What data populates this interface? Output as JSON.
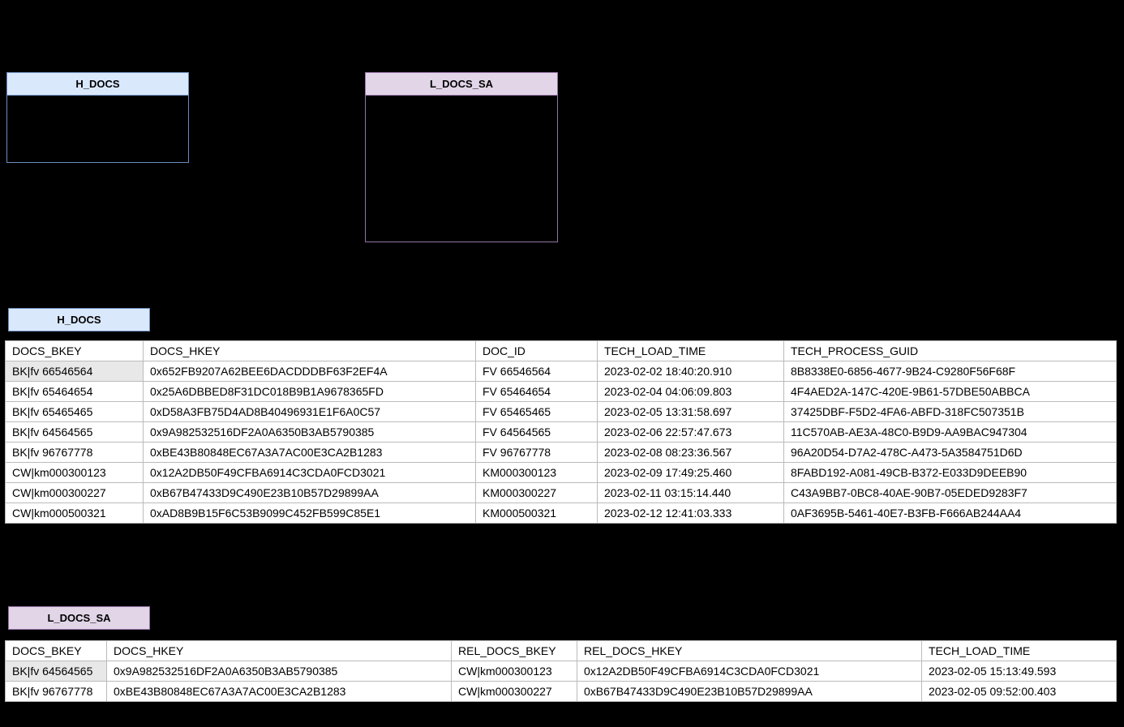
{
  "er": {
    "hdocs": {
      "title": "H_DOCS"
    },
    "ldocs": {
      "title": "L_DOCS_SA"
    }
  },
  "tabs": {
    "hdocs": "H_DOCS",
    "ldocs": "L_DOCS_SA"
  },
  "table1": {
    "headers": [
      "DOCS_BKEY",
      "DOCS_HKEY",
      "DOC_ID",
      "TECH_LOAD_TIME",
      "TECH_PROCESS_GUID"
    ],
    "rows": [
      [
        "BK|fv 66546564",
        "0x652FB9207A62BEE6DACDDDBF63F2EF4A",
        "FV 66546564",
        "2023-02-02 18:40:20.910",
        "8B8338E0-6856-4677-9B24-C9280F56F68F"
      ],
      [
        "BK|fv 65464654",
        "0x25A6DBBED8F31DC018B9B1A9678365FD",
        "FV 65464654",
        "2023-02-04 04:06:09.803",
        "4F4AED2A-147C-420E-9B61-57DBE50ABBCA"
      ],
      [
        "BK|fv 65465465",
        "0xD58A3FB75D4AD8B40496931E1F6A0C57",
        "FV 65465465",
        "2023-02-05 13:31:58.697",
        "37425DBF-F5D2-4FA6-ABFD-318FC507351B"
      ],
      [
        "BK|fv 64564565",
        "0x9A982532516DF2A0A6350B3AB5790385",
        "FV 64564565",
        "2023-02-06 22:57:47.673",
        "11C570AB-AE3A-48C0-B9D9-AA9BAC947304"
      ],
      [
        "BK|fv 96767778",
        "0xBE43B80848EC67A3A7AC00E3CA2B1283",
        "FV 96767778",
        "2023-02-08 08:23:36.567",
        "96A20D54-D7A2-478C-A473-5A3584751D6D"
      ],
      [
        "CW|km000300123",
        "0x12A2DB50F49CFBA6914C3CDA0FCD3021",
        "KM000300123",
        "2023-02-09 17:49:25.460",
        "8FABD192-A081-49CB-B372-E033D9DEEB90"
      ],
      [
        "CW|km000300227",
        "0xB67B47433D9C490E23B10B57D29899AA",
        "KM000300227",
        "2023-02-11 03:15:14.440",
        "C43A9BB7-0BC8-40AE-90B7-05EDED9283F7"
      ],
      [
        "CW|km000500321",
        "0xAD8B9B15F6C53B9099C452FB599C85E1",
        "KM000500321",
        "2023-02-12 12:41:03.333",
        "0AF3695B-5461-40E7-B3FB-F666AB244AA4"
      ]
    ]
  },
  "table2": {
    "headers": [
      "DOCS_BKEY",
      "DOCS_HKEY",
      "REL_DOCS_BKEY",
      "REL_DOCS_HKEY",
      "TECH_LOAD_TIME"
    ],
    "rows": [
      [
        "BK|fv 64564565",
        "0x9A982532516DF2A0A6350B3AB5790385",
        "CW|km000300123",
        "0x12A2DB50F49CFBA6914C3CDA0FCD3021",
        "2023-02-05 15:13:49.593"
      ],
      [
        "BK|fv 96767778",
        "0xBE43B80848EC67A3A7AC00E3CA2B1283",
        "CW|km000300227",
        "0xB67B47433D9C490E23B10B57D29899AA",
        "2023-02-05 09:52:00.403"
      ]
    ]
  }
}
